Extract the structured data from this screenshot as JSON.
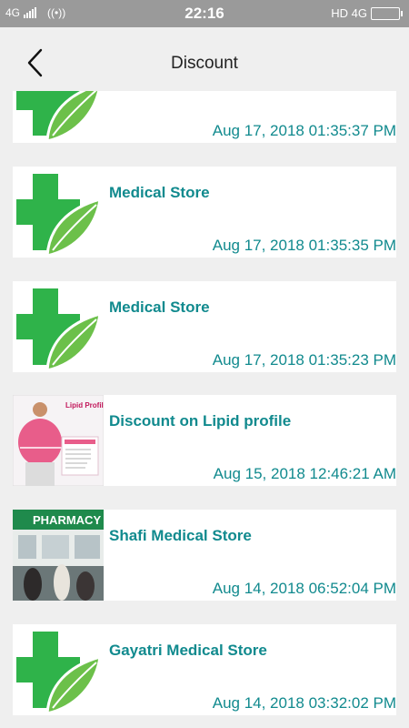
{
  "status_bar": {
    "left_network": "4G",
    "time": "22:16",
    "right_network": "HD 4G"
  },
  "header": {
    "title": "Discount"
  },
  "items": [
    {
      "title": "",
      "date": "Aug 17, 2018 01:35:37 PM",
      "image": "medical-cross-leaf-logo"
    },
    {
      "title": "Medical Store",
      "date": "Aug 17, 2018 01:35:35 PM",
      "image": "medical-cross-leaf-logo"
    },
    {
      "title": "Medical Store",
      "date": "Aug 17, 2018 01:35:23 PM",
      "image": "medical-cross-leaf-logo"
    },
    {
      "title": "Discount on Lipid profile",
      "date": "Aug 15, 2018 12:46:21 AM",
      "image": "lipid-profile-photo",
      "image_caption": "Lipid Profile"
    },
    {
      "title": "Shafi Medical Store",
      "date": "Aug 14, 2018 06:52:04 PM",
      "image": "pharmacy-storefront-photo",
      "image_caption": "PHARMACY"
    },
    {
      "title": "Gayatri Medical Store",
      "date": "Aug 14, 2018 03:32:02 PM",
      "image": "medical-cross-leaf-logo"
    }
  ],
  "colors": {
    "accent_text": "#118a8e",
    "cross_green": "#2fb34a",
    "leaf_green": "#6cc04a",
    "background": "#efefef"
  }
}
